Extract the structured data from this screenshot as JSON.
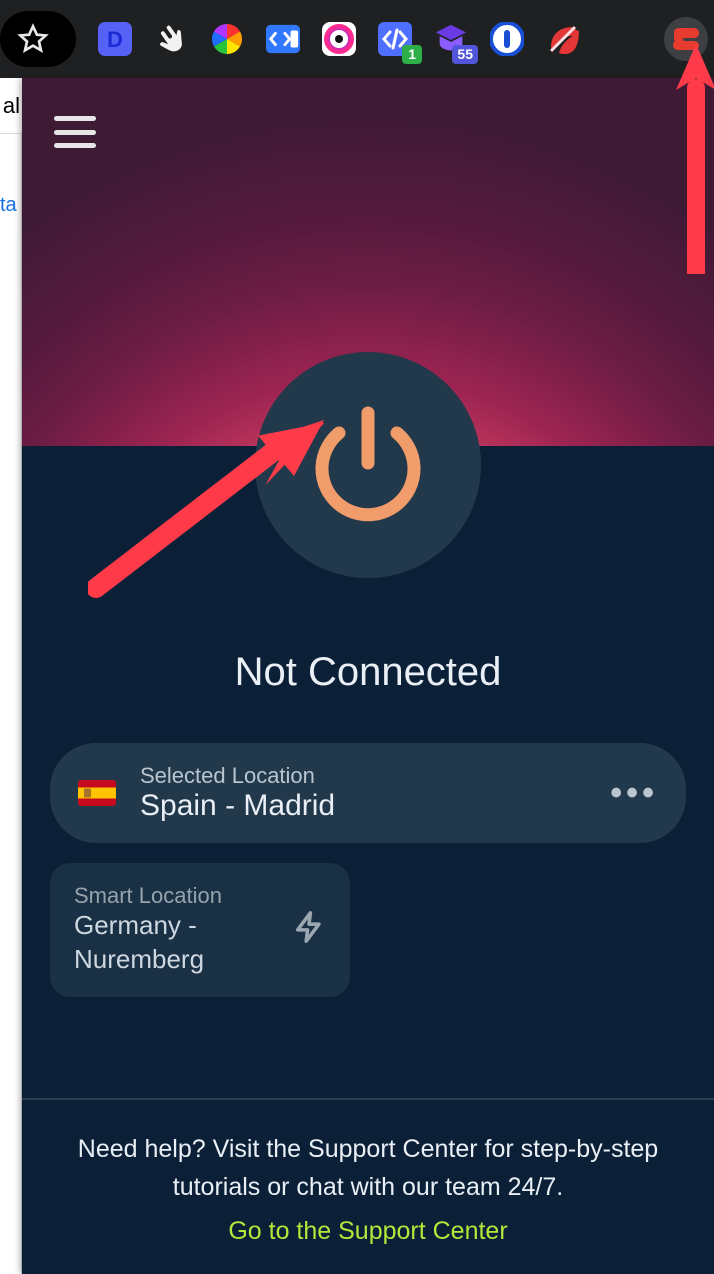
{
  "toolbar": {
    "extensions": [
      {
        "name": "bookmark-star",
        "glyph": "star"
      },
      {
        "name": "d-extension",
        "glyph": "D"
      },
      {
        "name": "hand-extension",
        "glyph": "hand"
      },
      {
        "name": "colorwheel-extension",
        "glyph": "colorwheel"
      },
      {
        "name": "code-extension",
        "glyph": "codebox"
      },
      {
        "name": "target-extension",
        "glyph": "target"
      },
      {
        "name": "devtools-extension",
        "glyph": "codeangles",
        "badge": "1",
        "badge_style": "green"
      },
      {
        "name": "graduation-extension",
        "glyph": "graduation",
        "badge": "55",
        "badge_style": "blue"
      },
      {
        "name": "onepassword-extension",
        "glyph": "1password"
      },
      {
        "name": "leaf-extension",
        "glyph": "leaf"
      },
      {
        "name": "expressvpn-extension",
        "glyph": "expressvpn"
      }
    ]
  },
  "page": {
    "tab_text": "al",
    "link_fragment": "ta"
  },
  "popup": {
    "status": "Not Connected",
    "selected": {
      "label": "Selected Location",
      "value": "Spain - Madrid",
      "flag": "es"
    },
    "smart": {
      "label": "Smart Location",
      "value": "Germany - Nuremberg"
    }
  },
  "footer": {
    "help_text": "Need help? Visit the Support Center for step-by-step tutorials or chat with our team 24/7.",
    "link_text": "Go to the Support Center"
  }
}
